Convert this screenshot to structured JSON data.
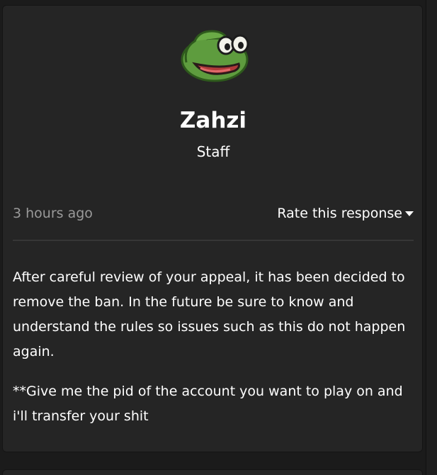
{
  "author": {
    "name": "Zahzi",
    "role": "Staff"
  },
  "response": {
    "timestamp": "3 hours ago",
    "rate_label": "Rate this response"
  },
  "message": {
    "paragraphs": [
      "After careful review of your appeal, it has been decided to remove the ban. In the future be sure to know and understand the rules so issues such as this do not happen again.",
      "**Give me the pid of the account you want to play on and i'll transfer your shit"
    ]
  },
  "icons": {
    "avatar": "frog-face-avatar",
    "rate_caret": "caret-down-icon"
  },
  "colors": {
    "background": "#1b1b1b",
    "card": "#252525",
    "muted_text": "#9a9a9a",
    "avatar_green": "#5a9a3a"
  }
}
